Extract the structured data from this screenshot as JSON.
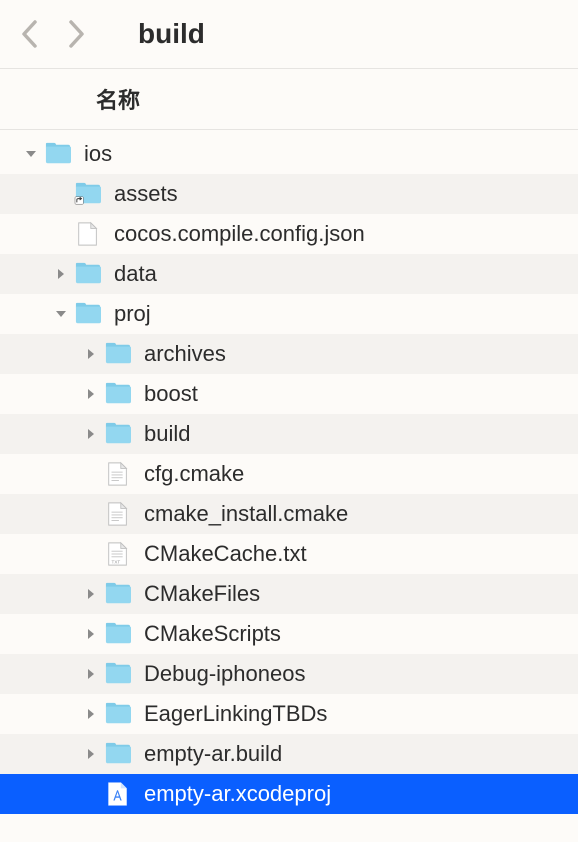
{
  "nav": {
    "title": "build"
  },
  "header": {
    "column_name": "名称"
  },
  "tree": [
    {
      "name": "ios",
      "type": "folder",
      "level": 0,
      "expanded": true,
      "has_children": true,
      "alt": false
    },
    {
      "name": "assets",
      "type": "folder-alias",
      "level": 1,
      "expanded": false,
      "has_children": false,
      "alt": true
    },
    {
      "name": "cocos.compile.config.json",
      "type": "file-blank",
      "level": 1,
      "expanded": false,
      "has_children": false,
      "alt": false
    },
    {
      "name": "data",
      "type": "folder",
      "level": 1,
      "expanded": false,
      "has_children": true,
      "alt": true
    },
    {
      "name": "proj",
      "type": "folder",
      "level": 1,
      "expanded": true,
      "has_children": true,
      "alt": false
    },
    {
      "name": "archives",
      "type": "folder",
      "level": 2,
      "expanded": false,
      "has_children": true,
      "alt": true
    },
    {
      "name": "boost",
      "type": "folder",
      "level": 2,
      "expanded": false,
      "has_children": true,
      "alt": false
    },
    {
      "name": "build",
      "type": "folder",
      "level": 2,
      "expanded": false,
      "has_children": true,
      "alt": true
    },
    {
      "name": "cfg.cmake",
      "type": "file-text",
      "level": 2,
      "expanded": false,
      "has_children": false,
      "alt": false
    },
    {
      "name": "cmake_install.cmake",
      "type": "file-text",
      "level": 2,
      "expanded": false,
      "has_children": false,
      "alt": true
    },
    {
      "name": "CMakeCache.txt",
      "type": "file-txt",
      "level": 2,
      "expanded": false,
      "has_children": false,
      "alt": false
    },
    {
      "name": "CMakeFiles",
      "type": "folder",
      "level": 2,
      "expanded": false,
      "has_children": true,
      "alt": true
    },
    {
      "name": "CMakeScripts",
      "type": "folder",
      "level": 2,
      "expanded": false,
      "has_children": true,
      "alt": false
    },
    {
      "name": "Debug-iphoneos",
      "type": "folder",
      "level": 2,
      "expanded": false,
      "has_children": true,
      "alt": true
    },
    {
      "name": "EagerLinkingTBDs",
      "type": "folder",
      "level": 2,
      "expanded": false,
      "has_children": true,
      "alt": false
    },
    {
      "name": "empty-ar.build",
      "type": "folder",
      "level": 2,
      "expanded": false,
      "has_children": true,
      "alt": true
    },
    {
      "name": "empty-ar.xcodeproj",
      "type": "file-xcode",
      "level": 2,
      "expanded": false,
      "has_children": false,
      "alt": false,
      "selected": true
    }
  ]
}
